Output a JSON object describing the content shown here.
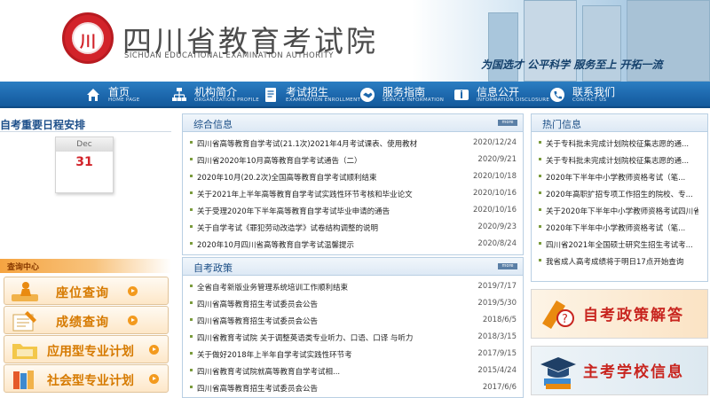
{
  "header": {
    "title_cn": "四川省教育考试院",
    "title_en": "SICHUAN EDUCATIONAL EXAMINATION AUTHORITY",
    "slogan": "为国选才  公平科学  服务至上  开拓一流",
    "logo_glyph": "川"
  },
  "nav": {
    "items": [
      {
        "label": "首页",
        "sub": "HOME PAGE",
        "icon": "home-icon"
      },
      {
        "label": "机构简介",
        "sub": "ORGANIZATION PROFILE",
        "icon": "org-chart-icon"
      },
      {
        "label": "考试招生",
        "sub": "EXAMINATION ENROLLMENT",
        "icon": "document-icon"
      },
      {
        "label": "服务指南",
        "sub": "SERVICE INFORMATION",
        "icon": "handshake-icon"
      },
      {
        "label": "信息公开",
        "sub": "INFORMATION DISCLOSURE",
        "icon": "info-icon"
      },
      {
        "label": "联系我们",
        "sub": "CONTACT US",
        "icon": "phone-icon"
      }
    ]
  },
  "schedule": {
    "title": "自考重要日程安排",
    "month": "Dec",
    "day": "31"
  },
  "query": {
    "title": "查询中心",
    "buttons": [
      {
        "label": "座位查询",
        "icon": "person-seat-icon"
      },
      {
        "label": "成绩查询",
        "icon": "pencil-paper-icon"
      },
      {
        "label": "应用型专业计划",
        "icon": "folder-icon"
      },
      {
        "label": "社会型专业计划",
        "icon": "books-icon"
      }
    ]
  },
  "general_info": {
    "title": "综合信息",
    "more": "more",
    "items": [
      {
        "title": "四川省高等教育自学考试(21.1次)2021年4月考试课表、使用教材",
        "date": "2020/12/24"
      },
      {
        "title": "四川省2020年10月高等教育自学考试通告（二）",
        "date": "2020/9/21"
      },
      {
        "title": "2020年10月(20.2次)全国高等教育自学考试顺利结束",
        "date": "2020/10/18"
      },
      {
        "title": "关于2021年上半年高等教育自学考试实践性环节考核和毕业论文",
        "date": "2020/10/16"
      },
      {
        "title": "关于受理2020年下半年高等教育自学考试毕业申请的通告",
        "date": "2020/10/16"
      },
      {
        "title": "关于自学考试《罪犯劳动改造学》试卷结构调整的说明",
        "date": "2020/9/23"
      },
      {
        "title": "2020年10月四川省高等教育自学考试温馨提示",
        "date": "2020/8/24"
      }
    ]
  },
  "policy": {
    "title": "自考政策",
    "more": "more",
    "items": [
      {
        "title": "全省自考新版业务管理系统培训工作顺利结束",
        "date": "2019/7/17"
      },
      {
        "title": "四川省高等教育招生考试委员会公告",
        "date": "2019/5/30"
      },
      {
        "title": "四川省高等教育招生考试委员会公告",
        "date": "2018/6/5"
      },
      {
        "title": "四川省教育考试院 关于调整英语类专业听力、口语、口译 与听力",
        "date": "2018/3/15"
      },
      {
        "title": "关于做好2018年上半年自学考试实践性环节考",
        "date": "2017/9/15"
      },
      {
        "title": "四川省教育考试院就高等教育自学考试相...",
        "date": "2015/4/24"
      },
      {
        "title": "四川省高等教育招生考试委员会公告",
        "date": "2017/6/6"
      }
    ]
  },
  "hot": {
    "title": "热门信息",
    "items": [
      "关于专科批未完成计划院校征集志愿的通...",
      "关于专科批未完成计划院校征集志愿的通...",
      "2020年下半年中小学教师资格考试（笔...",
      "2020年高职扩招专项工作招生的院校、专...",
      "关于2020年下半年中小学教师资格考试四川省...",
      "2020年下半年中小学教师资格考试（笔...",
      "四川省2021年全国硕士研究生招生考试考...",
      "我省成人高考成绩将于明日17点开始查询"
    ]
  },
  "banners": [
    {
      "label": "自考政策解答",
      "icon": "question-mark-icon",
      "color": "#c8251f"
    },
    {
      "label": "主考学校信息",
      "icon": "graduation-cap-icon",
      "color": "#c8251f"
    }
  ],
  "colors": {
    "nav_blue": "#1d68ad",
    "accent_orange": "#f39a1e",
    "title_blue": "#1b4e86",
    "brand_red": "#d2232a"
  }
}
